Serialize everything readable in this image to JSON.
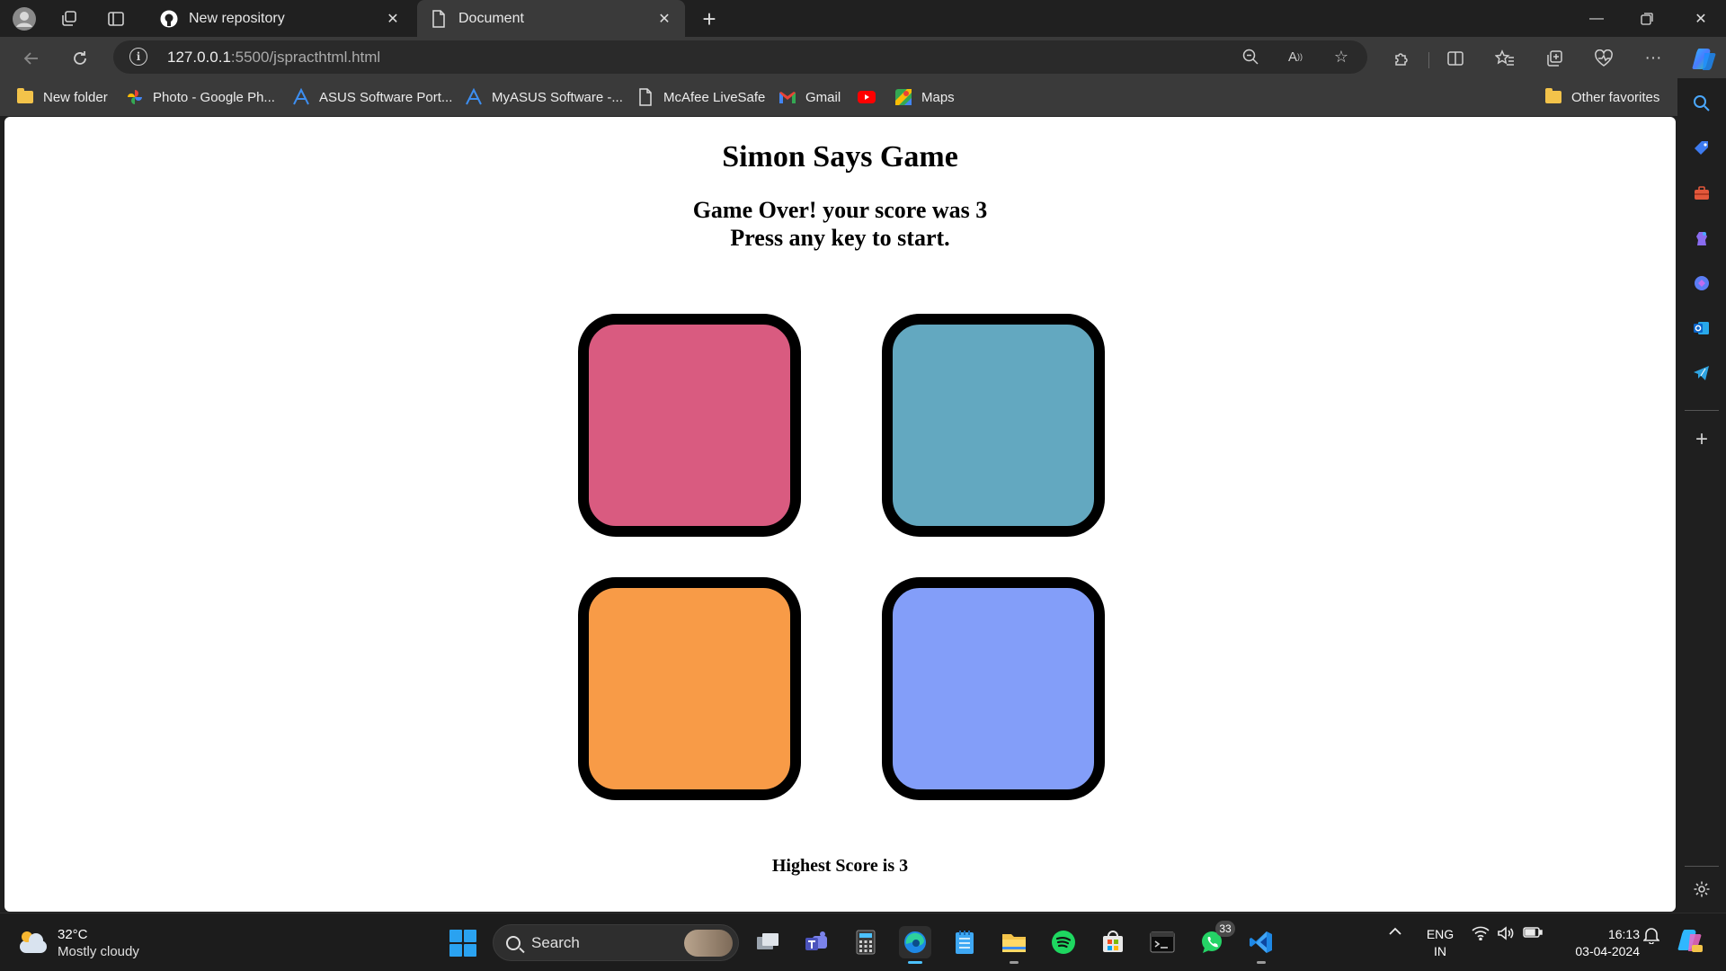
{
  "browser": {
    "tabs": [
      {
        "label": "New repository",
        "icon": "github-icon",
        "active": false
      },
      {
        "label": "Document",
        "icon": "page-icon",
        "active": true
      }
    ],
    "url": {
      "host": "127.0.0.1",
      "path": ":5500/jspracthtml.html"
    },
    "favorites": [
      {
        "label": "New folder",
        "icon": "folder-icon"
      },
      {
        "label": "Photo - Google Ph...",
        "icon": "google-photos-icon"
      },
      {
        "label": "ASUS Software Port...",
        "icon": "asus-icon"
      },
      {
        "label": "MyASUS Software -...",
        "icon": "asus-icon"
      },
      {
        "label": "McAfee LiveSafe",
        "icon": "page-icon"
      },
      {
        "label": "Gmail",
        "icon": "gmail-icon"
      },
      {
        "label": "",
        "icon": "youtube-icon"
      },
      {
        "label": "Maps",
        "icon": "maps-icon"
      }
    ],
    "other_favorites": "Other favorites"
  },
  "page": {
    "title": "Simon Says Game",
    "status_line1": "Game Over! your score was 3",
    "status_line2": "Press any key to start.",
    "buttons": [
      {
        "name": "red",
        "color": "#d95b80"
      },
      {
        "name": "blue",
        "color": "#63a8c0"
      },
      {
        "name": "orange",
        "color": "#f89b47"
      },
      {
        "name": "purple",
        "color": "#839ef9"
      }
    ],
    "highest_score": "Highest Score is 3"
  },
  "taskbar": {
    "weather": {
      "temp": "32°C",
      "desc": "Mostly cloudy"
    },
    "search_label": "Search",
    "whatsapp_badge": "33",
    "lang": {
      "line1": "ENG",
      "line2": "IN"
    },
    "clock": {
      "time": "16:13",
      "date": "03-04-2024"
    }
  }
}
